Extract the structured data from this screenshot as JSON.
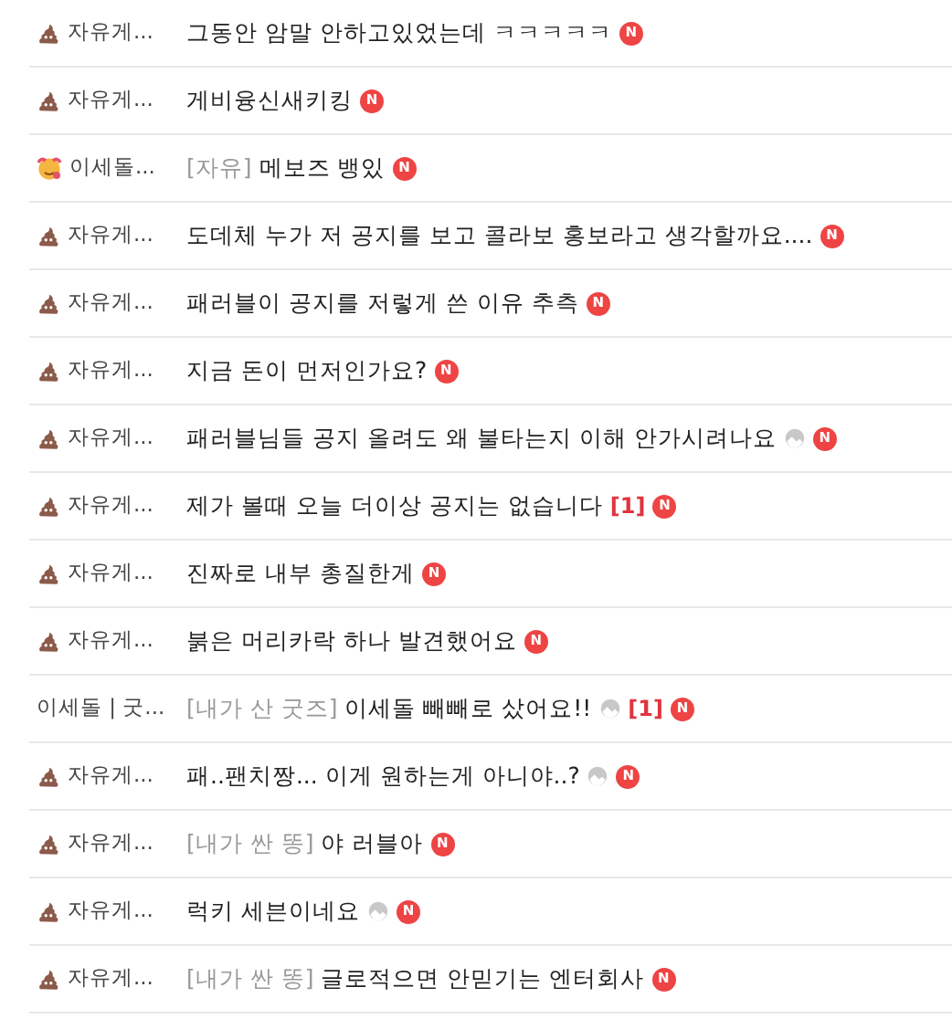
{
  "posts": [
    {
      "kind": "poop",
      "board": "자유게...",
      "title": "그동안 암말 안하고있었는데 ㅋㅋㅋㅋㅋ",
      "has_image": false,
      "badge": "N"
    },
    {
      "kind": "poop",
      "board": "자유게...",
      "title": "게비융신새키킹",
      "has_image": false,
      "badge": "N"
    },
    {
      "kind": "face",
      "board": "이세돌...",
      "tag": "[자유]",
      "title": "메보즈 뱅있",
      "has_image": false,
      "badge": "N"
    },
    {
      "kind": "poop",
      "board": "자유게...",
      "title": "도데체 누가 저 공지를 보고 콜라보 홍보라고 생각할까요....",
      "has_image": false,
      "badge": "N"
    },
    {
      "kind": "poop",
      "board": "자유게...",
      "title": "패러블이 공지를 저렇게 쓴 이유 추측",
      "has_image": false,
      "badge": "N"
    },
    {
      "kind": "poop",
      "board": "자유게...",
      "title": "지금 돈이 먼저인가요?",
      "has_image": false,
      "badge": "N"
    },
    {
      "kind": "poop",
      "board": "자유게...",
      "title": "패러블님들 공지 올려도 왜 불타는지 이해 안가시려나요",
      "has_image": true,
      "badge": "N"
    },
    {
      "kind": "poop",
      "board": "자유게...",
      "title": "제가 볼때 오늘 더이상 공지는 없습니다",
      "has_image": false,
      "comments": "[1]",
      "badge": "N"
    },
    {
      "kind": "poop",
      "board": "자유게...",
      "title": "진짜로 내부 총질한게",
      "has_image": false,
      "badge": "N"
    },
    {
      "kind": "poop",
      "board": "자유게...",
      "title": "붉은 머리카락 하나 발견했어요",
      "has_image": false,
      "badge": "N"
    },
    {
      "board": "이세돌 | 굿...",
      "tag": "[내가 산 굿즈]",
      "title": "이세돌 빼빼로 샀어요!!",
      "has_image": true,
      "comments": "[1]",
      "badge": "N"
    },
    {
      "kind": "poop",
      "board": "자유게...",
      "title": "패..팬치짱... 이게 원하는게 아니야..?",
      "has_image": true,
      "badge": "N"
    },
    {
      "kind": "poop",
      "board": "자유게...",
      "tag": "[내가 싼 똥]",
      "title": "야 러블아",
      "has_image": false,
      "badge": "N"
    },
    {
      "kind": "poop",
      "board": "자유게...",
      "title": "럭키 세븐이네요",
      "has_image": true,
      "badge": "N"
    },
    {
      "kind": "poop",
      "board": "자유게...",
      "tag": "[내가 싼 똥]",
      "title": "글로적으면 안믿기는 엔터회사",
      "has_image": false,
      "badge": "N"
    }
  ]
}
